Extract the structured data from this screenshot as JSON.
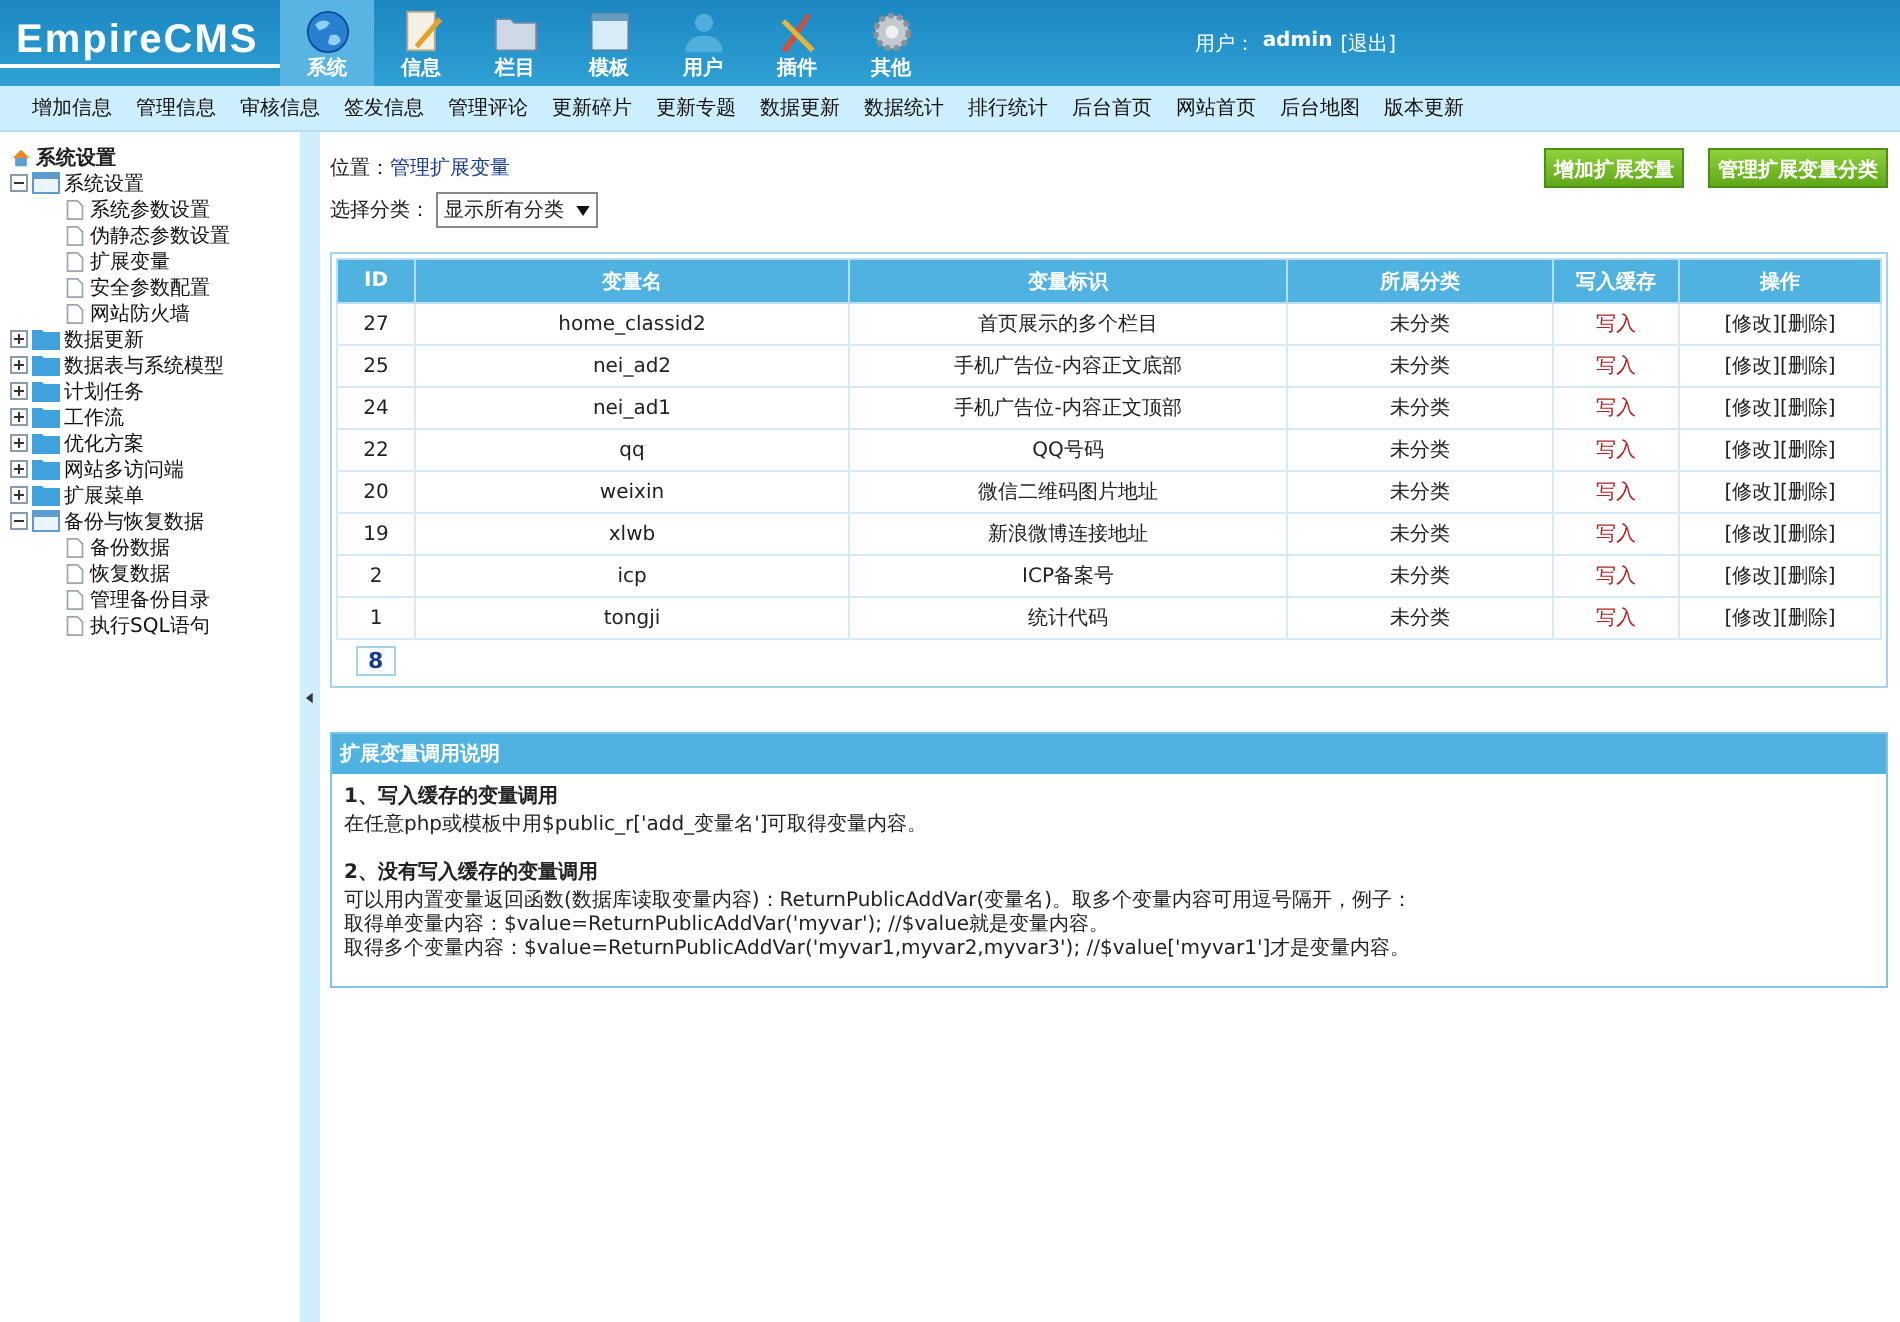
{
  "header": {
    "logo": "EmpireCMS",
    "tabs": [
      {
        "label": "系统",
        "selected": true
      },
      {
        "label": "信息",
        "selected": false
      },
      {
        "label": "栏目",
        "selected": false
      },
      {
        "label": "模板",
        "selected": false
      },
      {
        "label": "用户",
        "selected": false
      },
      {
        "label": "插件",
        "selected": false
      },
      {
        "label": "其他",
        "selected": false
      }
    ],
    "user_label": "用户：",
    "user": "admin",
    "logout": "[退出]"
  },
  "menu": [
    "增加信息",
    "管理信息",
    "审核信息",
    "签发信息",
    "管理评论",
    "更新碎片",
    "更新专题",
    "数据更新",
    "数据统计",
    "排行统计",
    "后台首页",
    "网站首页",
    "后台地图",
    "版本更新"
  ],
  "sidebar": {
    "title": "系统设置",
    "items": [
      {
        "label": "系统设置",
        "expanded": true,
        "children": [
          {
            "label": "系统参数设置"
          },
          {
            "label": "伪静态参数设置"
          },
          {
            "label": "扩展变量"
          },
          {
            "label": "安全参数配置"
          },
          {
            "label": "网站防火墙"
          }
        ]
      },
      {
        "label": "数据更新",
        "expanded": false
      },
      {
        "label": "数据表与系统模型",
        "expanded": false
      },
      {
        "label": "计划任务",
        "expanded": false
      },
      {
        "label": "工作流",
        "expanded": false
      },
      {
        "label": "优化方案",
        "expanded": false
      },
      {
        "label": "网站多访问端",
        "expanded": false
      },
      {
        "label": "扩展菜单",
        "expanded": false
      },
      {
        "label": "备份与恢复数据",
        "expanded": true,
        "children": [
          {
            "label": "备份数据"
          },
          {
            "label": "恢复数据"
          },
          {
            "label": "管理备份目录"
          },
          {
            "label": "执行SQL语句"
          }
        ]
      }
    ]
  },
  "location": {
    "label": "位置：",
    "link": "管理扩展变量"
  },
  "buttons": [
    "增加扩展变量",
    "管理扩展变量分类"
  ],
  "filter": {
    "label": "选择分类：",
    "value": "显示所有分类"
  },
  "table": {
    "columns": [
      "ID",
      "变量名",
      "变量标识",
      "所属分类",
      "写入缓存",
      "操作"
    ],
    "rows": [
      [
        "27",
        "home_classid2",
        "首页展示的多个栏目",
        "未分类",
        "写入",
        "[修改]",
        "[删除]"
      ],
      [
        "25",
        "nei_ad2",
        "手机广告位-内容正文底部",
        "未分类",
        "写入",
        "[修改]",
        "[删除]"
      ],
      [
        "24",
        "nei_ad1",
        "手机广告位-内容正文顶部",
        "未分类",
        "写入",
        "[修改]",
        "[删除]"
      ],
      [
        "22",
        "qq",
        "QQ号码",
        "未分类",
        "写入",
        "[修改]",
        "[删除]"
      ],
      [
        "20",
        "weixin",
        "微信二维码图片地址",
        "未分类",
        "写入",
        "[修改]",
        "[删除]"
      ],
      [
        "19",
        "xlwb",
        "新浪微博连接地址",
        "未分类",
        "写入",
        "[修改]",
        "[删除]"
      ],
      [
        "2",
        "icp",
        "ICP备案号",
        "未分类",
        "写入",
        "[修改]",
        "[删除]"
      ],
      [
        "1",
        "tongji",
        "统计代码",
        "未分类",
        "写入",
        "[修改]",
        "[删除]"
      ]
    ],
    "total": "8"
  },
  "help": {
    "title": "扩展变量调用说明",
    "sections": [
      {
        "heading": "1、写入缓存的变量调用",
        "lines": [
          "在任意php或模板中用$public_r['add_变量名']可取得变量内容。"
        ]
      },
      {
        "heading": "2、没有写入缓存的变量调用",
        "lines": [
          "可以用内置变量返回函数(数据库读取变量内容)：ReturnPublicAddVar(变量名)。取多个变量内容可用逗号隔开，例子：",
          "取得单变量内容：$value=ReturnPublicAddVar('myvar'); //$value就是变量内容。",
          "取得多个变量内容：$value=ReturnPublicAddVar('myvar1,myvar2,myvar3'); //$value['myvar1']才是变量内容。"
        ]
      }
    ]
  }
}
